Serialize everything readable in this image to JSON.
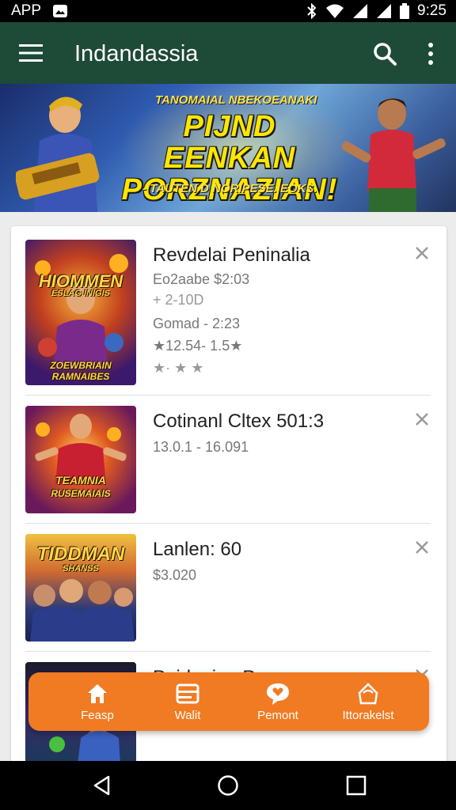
{
  "status_bar": {
    "left_label": "APP",
    "time": "9:25"
  },
  "app_bar": {
    "title": "Indandassia",
    "menu_icon": "hamburger-menu-icon",
    "search_icon": "search-icon",
    "more_icon": "more-vertical-icon"
  },
  "banner": {
    "kicker": "TANOMAIAL NBEKOEANAKI",
    "headline": "PIJND EENKAN PORZNAZIAN!",
    "tagline": "- TAUTEN D NORIPESE. EOKS."
  },
  "list": {
    "items": [
      {
        "art_title": "HIOMMEN",
        "art_subtitle": "ESLAG  INIGIS",
        "art_footer": "ZOEWBRIAIN RAMNAIBES",
        "name": "Revdelai Peninalia",
        "line1": "Eo2aabe $2:03",
        "line2": "+ 2-10D",
        "line3": "Gomad - 2:23",
        "line4": "★12.54- 1.5★",
        "line5": "★· ★ ★",
        "close_icon": "close-icon"
      },
      {
        "art_title": "TEAMNIA",
        "art_footer": "RUSEMAIAIS",
        "name": "Cotinanl Cltex 501:3",
        "line1": "13.0.1 - 16.091",
        "close_icon": "close-icon"
      },
      {
        "art_title": "TIDDMAN",
        "art_subtitle": "SHANSS",
        "name": "Lanlen: 60",
        "line1": "$3.020",
        "close_icon": "close-icon"
      },
      {
        "name": "Paidnoinn Pn",
        "close_icon": "close-icon"
      }
    ]
  },
  "bottom_nav": {
    "items": [
      {
        "label": "Feasp",
        "icon": "home-icon"
      },
      {
        "label": "Walit",
        "icon": "wallet-icon"
      },
      {
        "label": "Pemont",
        "icon": "chat-heart-icon"
      },
      {
        "label": "Ittorakelst",
        "icon": "gift-icon"
      }
    ],
    "color": "#f07b22"
  },
  "colors": {
    "app_bar": "#1e4a38",
    "accent": "#f07b22"
  }
}
